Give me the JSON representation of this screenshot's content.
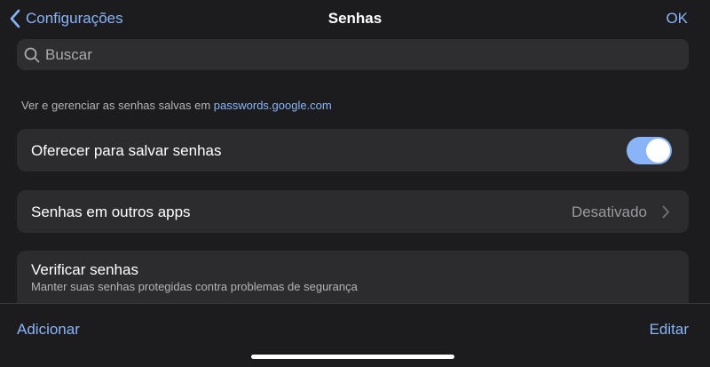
{
  "nav": {
    "back_label": "Configurações",
    "title": "Senhas",
    "done_label": "OK"
  },
  "search": {
    "placeholder": "Buscar",
    "value": ""
  },
  "info": {
    "prefix": "Ver e gerenciar as senhas salvas em ",
    "link": "passwords.google.com"
  },
  "offer_save": {
    "label": "Oferecer para salvar senhas",
    "enabled": true
  },
  "other_apps": {
    "label": "Senhas em outros apps",
    "value": "Desativado"
  },
  "check_passwords": {
    "title": "Verificar senhas",
    "subtitle": "Manter suas senhas protegidas contra problemas de segurança"
  },
  "toolbar": {
    "add_label": "Adicionar",
    "edit_label": "Editar"
  },
  "colors": {
    "accent": "#8ab4f8",
    "background": "#1c1c1e",
    "card": "#2c2c2e"
  },
  "icons": {
    "back": "chevron-left-icon",
    "search": "search-icon",
    "disclosure": "chevron-right-icon"
  }
}
